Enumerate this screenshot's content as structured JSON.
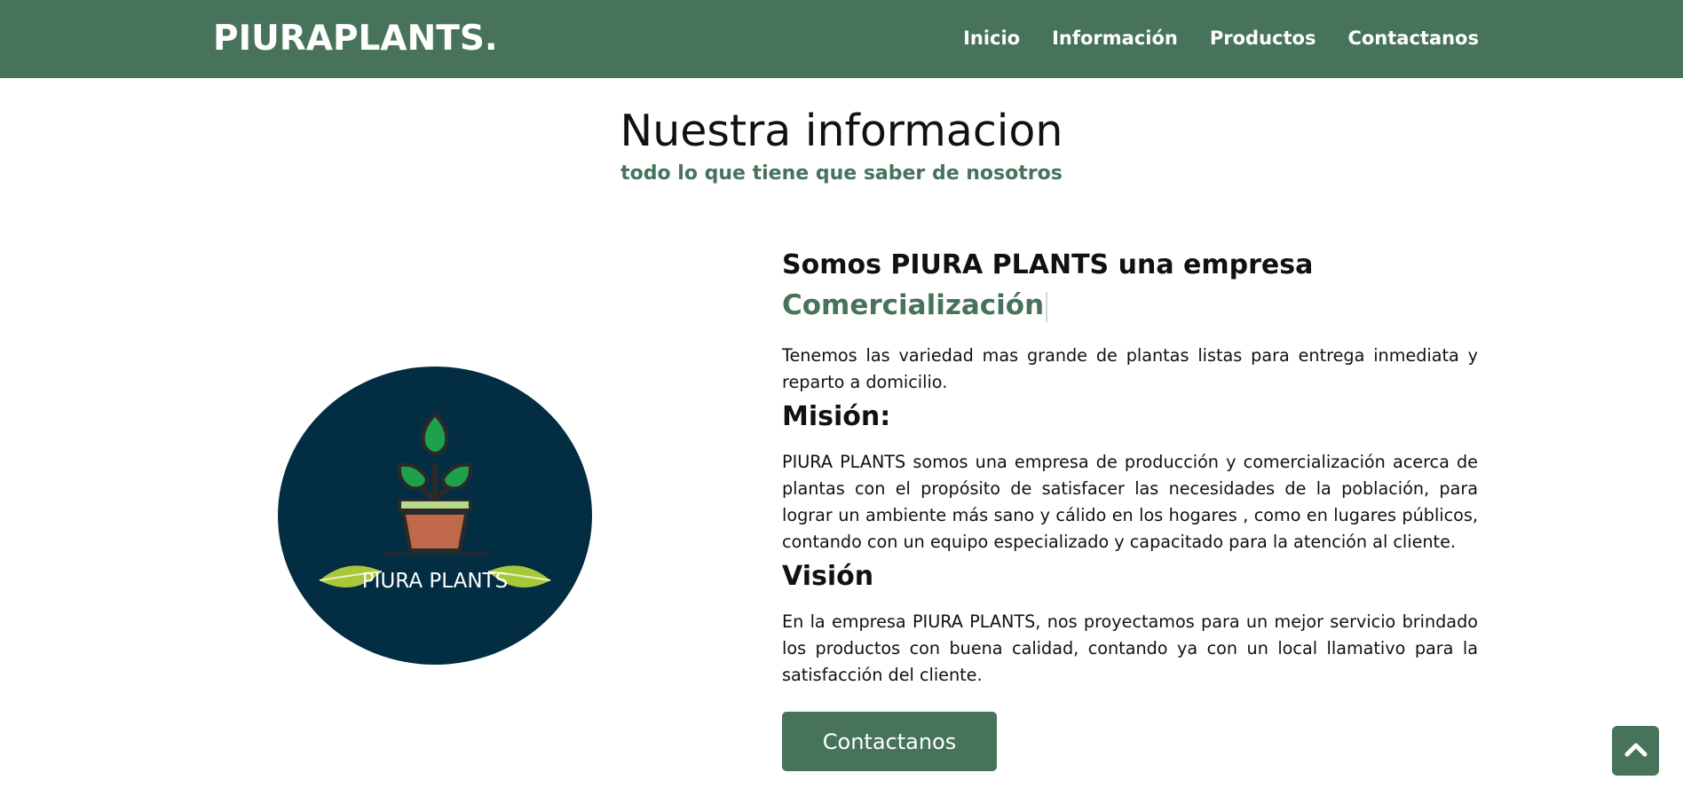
{
  "navbar": {
    "brand": "PIURAPLANTS.",
    "links": [
      "Inicio",
      "Información",
      "Productos",
      "Contactanos"
    ]
  },
  "header": {
    "title": "Nuestra informacion",
    "subtitle": "todo lo que tiene que saber de nosotros"
  },
  "logo": {
    "text": "PIURA PLANTS",
    "icon": "plant-pot-logo"
  },
  "about": {
    "intro_heading": "Somos PIURA PLANTS una empresa",
    "rotating_word": "Comercialización",
    "intro_text": "Tenemos las variedad mas grande de plantas listas para entrega inmediata y reparto a domicilio.",
    "mision_heading": "Misión:",
    "mision_text": "PIURA PLANTS somos una empresa de producción y comercialización acerca de plantas con el propósito de satisfacer las necesidades de la población, para lograr un ambiente más sano y cálido en los hogares , como en lugares públicos, contando con un equipo especializado y capacitado para la atención al cliente.",
    "vision_heading": "Visión",
    "vision_text": "En la empresa PIURA PLANTS, nos proyectamos para un mejor servicio brindado los productos con buena calidad, contando ya con un local llamativo para la satisfacción del cliente.",
    "cta_label": "Contactanos"
  },
  "scroll_top": {
    "icon": "chevron-up-icon"
  },
  "colors": {
    "primary": "#47735b",
    "logo_bg": "#032d43",
    "text": "#111111",
    "white": "#ffffff"
  }
}
